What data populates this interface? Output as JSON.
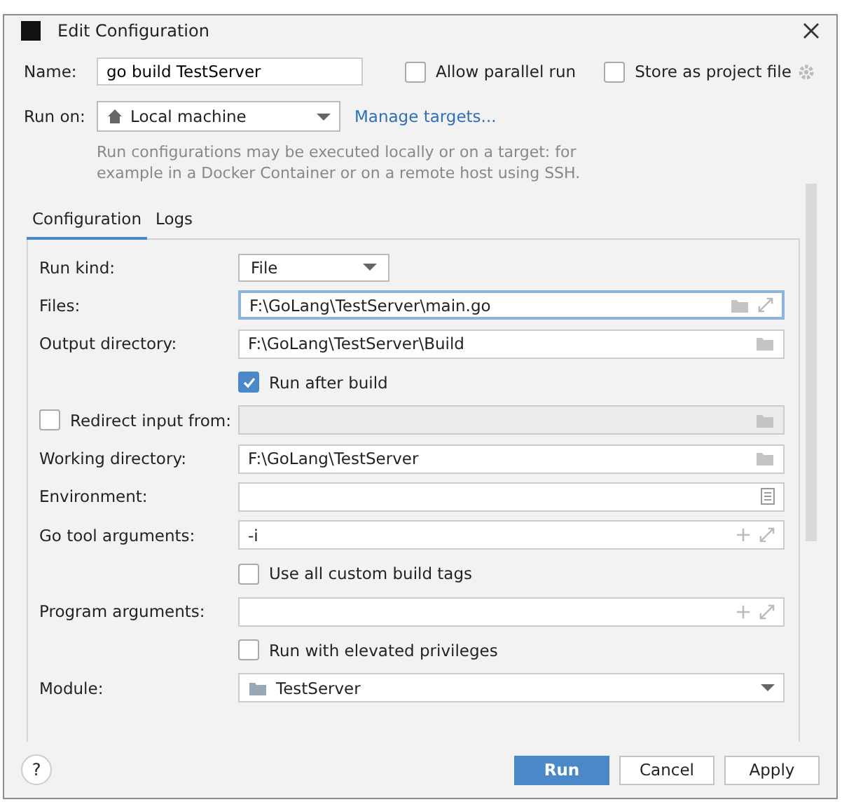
{
  "window": {
    "title": "Edit Configuration"
  },
  "name": {
    "label": "Name:",
    "value": "go build TestServer"
  },
  "options": [
    {
      "label": "Allow parallel run",
      "checked": false
    },
    {
      "label": "Store as project file",
      "checked": false
    }
  ],
  "run_on": {
    "label": "Run on:",
    "value": "Local machine",
    "link": "Manage targets...",
    "hint": "Run configurations may be executed locally or on a target: for example in a Docker Container or on a remote host using SSH."
  },
  "tabs": [
    {
      "label": "Configuration",
      "selected": true
    },
    {
      "label": "Logs",
      "selected": false
    }
  ],
  "rows": [
    {
      "kind": "select",
      "label": "Run kind:",
      "value": "File"
    },
    {
      "kind": "file",
      "label": "Files:",
      "value": "F:\\GoLang\\TestServer\\main.go",
      "focused": true
    },
    {
      "kind": "dir",
      "label": "Output directory:",
      "value": "F:\\GoLang\\TestServer\\Build",
      "focused": false
    },
    {
      "kind": "check",
      "label": "Run after build",
      "checked": true
    },
    {
      "kind": "checkdir",
      "label": "Redirect input from:",
      "checked": false
    },
    {
      "kind": "dir",
      "label": "Working directory:",
      "value": "F:\\GoLang\\TestServer",
      "focused": false
    },
    {
      "kind": "env",
      "label": "Environment:"
    },
    {
      "kind": "args",
      "label": "Go tool arguments:",
      "value": "-i"
    },
    {
      "kind": "check",
      "label": "Use all custom build tags",
      "checked": false
    },
    {
      "kind": "args",
      "label": "Program arguments:"
    },
    {
      "kind": "check",
      "label": "Run with elevated privileges",
      "checked": false
    },
    {
      "kind": "module",
      "label": "Module:",
      "value": "TestServer"
    }
  ],
  "help": "?",
  "buttons": [
    {
      "label": "Run",
      "primary": true
    },
    {
      "label": "Cancel",
      "primary": false
    },
    {
      "label": "Apply",
      "primary": false
    }
  ]
}
